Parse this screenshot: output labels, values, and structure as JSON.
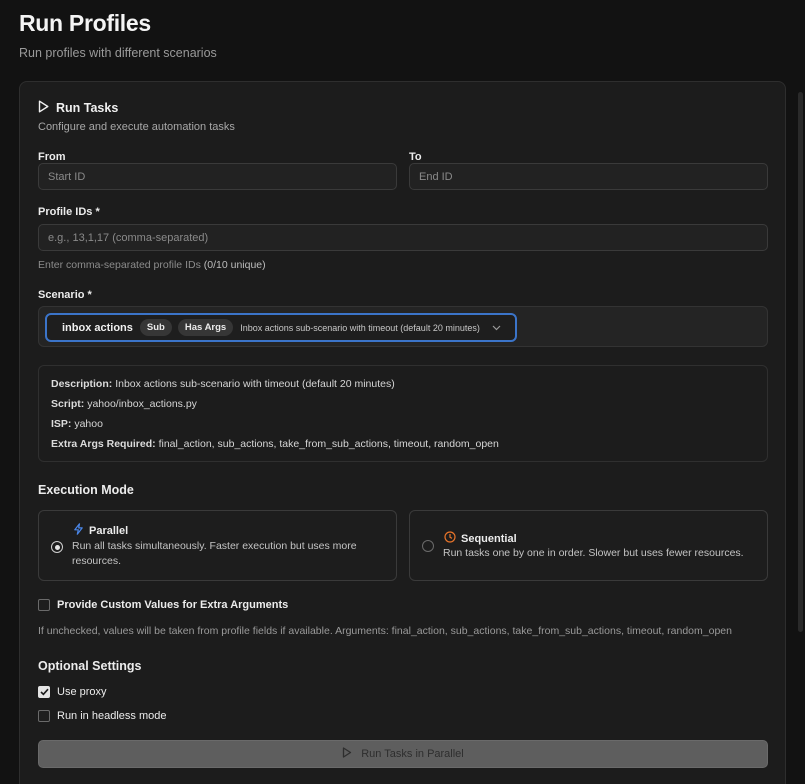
{
  "header": {
    "title": "Run Profiles",
    "subtitle": "Run profiles with different scenarios"
  },
  "card": {
    "title": "Run Tasks",
    "description": "Configure and execute automation tasks"
  },
  "range": {
    "from_label": "From",
    "from_placeholder": "Start ID",
    "to_label": "To",
    "to_placeholder": "End ID"
  },
  "profile_ids": {
    "label": "Profile IDs *",
    "placeholder": "e.g., 13,1,17 (comma-separated)",
    "hint": "Enter comma-separated profile IDs",
    "count": "(0/10 unique)"
  },
  "scenario": {
    "label": "Scenario *",
    "selected_name": "inbox actions",
    "badge_sub": "Sub",
    "badge_args": "Has Args",
    "selected_description": "Inbox actions sub-scenario with timeout (default 20 minutes)"
  },
  "info": {
    "description_label": "Description:",
    "description_value": "Inbox actions sub-scenario with timeout (default 20 minutes)",
    "script_label": "Script:",
    "script_value": "yahoo/inbox_actions.py",
    "isp_label": "ISP:",
    "isp_value": "yahoo",
    "extra_args_label": "Extra Args Required:",
    "extra_args_value": "final_action, sub_actions, take_from_sub_actions, timeout, random_open"
  },
  "execution_mode": {
    "title": "Execution Mode",
    "parallel": {
      "title": "Parallel",
      "text_line1": "Run all tasks simultaneously. Faster execution but uses more",
      "text_line2": "resources.",
      "selected": true
    },
    "sequential": {
      "title": "Sequential",
      "text": "Run tasks one by one in order. Slower but uses fewer resources.",
      "selected": false
    }
  },
  "custom_values": {
    "label": "Provide Custom Values for Extra Arguments",
    "checked": false,
    "hint": "If unchecked, values will be taken from profile fields if available. Arguments: final_action, sub_actions, take_from_sub_actions, timeout, random_open"
  },
  "optional_settings": {
    "title": "Optional Settings",
    "use_proxy_label": "Use proxy",
    "use_proxy_checked": true,
    "headless_label": "Run in headless mode",
    "headless_checked": false
  },
  "run_button": {
    "label": "Run Tasks in Parallel"
  },
  "colors": {
    "accent_focus": "#3b74c9",
    "parallel_icon": "#4a86e8",
    "sequential_icon": "#e8742a",
    "background": "#121212",
    "card": "#1c1c1c"
  },
  "icons": {
    "card_title": "play-icon",
    "parallel": "lightning-icon",
    "sequential": "clock-icon",
    "select": "chevron-down-icon",
    "run_button": "play-icon"
  }
}
